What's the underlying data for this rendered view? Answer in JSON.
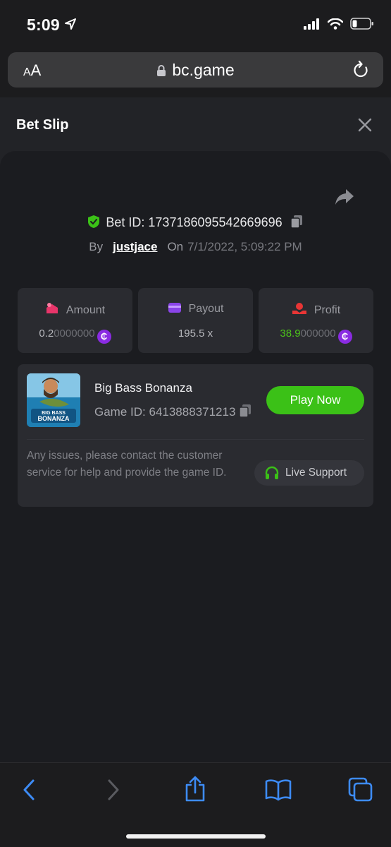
{
  "status_bar": {
    "time": "5:09"
  },
  "browser": {
    "aa_small": "A",
    "aa_big": "A",
    "url": "bc.game"
  },
  "header": {
    "title": "Bet Slip"
  },
  "bet": {
    "id_label": "Bet ID:",
    "id": "1737186095542669696",
    "by_label": "By",
    "user": "justjace",
    "on_label": "On",
    "date": "7/1/2022, 5:09:22 PM"
  },
  "stats": {
    "amount_label": "Amount",
    "amount_main": "0.2",
    "amount_dim": "0000000",
    "payout_label": "Payout",
    "payout_value": "195.5 x",
    "profit_label": "Profit",
    "profit_main": "38.9",
    "profit_dim": "000000",
    "coin_symbol": "₵"
  },
  "game": {
    "title": "Big Bass Bonanza",
    "id_label": "Game ID:",
    "id": "6413888371213",
    "play_label": "Play Now",
    "thumb_text_top": "BIG BASS",
    "thumb_text_bottom": "BONANZA",
    "issues_text": "Any issues, please contact the customer service for help and provide the game ID.",
    "live_support_label": "Live Support"
  },
  "colors": {
    "accent_green": "#3bc117",
    "coin_purple": "#8a2be2",
    "shield_green": "#3bc117",
    "ios_blue": "#3d8bf5"
  }
}
